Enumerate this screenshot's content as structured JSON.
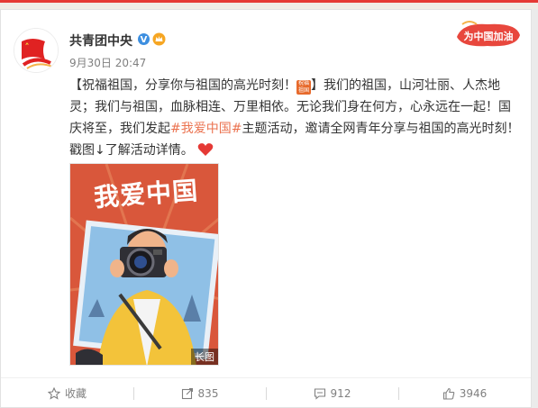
{
  "user": {
    "name": "共青团中央",
    "verified_icon": "verified-icon",
    "badge_icon": "crown-icon"
  },
  "post": {
    "time": "9月30日 20:47",
    "text_part1": "【祝福祖国，分享你与祖国的高光时刻！",
    "sticker_text": "祝福祖国",
    "text_part2": "】我们的祖国，山河壮丽、人杰地灵；我们与祖国，血脉相连、万里相依。无论我们身在何方，心永远在一起！国庆将至，我们发起",
    "topic": "#我爱中国#",
    "text_part3": "主题活动，邀请全网青年分享与祖国的高光时刻！戳图↓了解活动详情。",
    "emoji": "heart-icon"
  },
  "image": {
    "title": "我爱中国",
    "long_tag": "长图"
  },
  "campaign": {
    "label": "为中国加油"
  },
  "actions": [
    {
      "label": "收藏",
      "icon": "star-icon"
    },
    {
      "label": "835",
      "icon": "share-icon"
    },
    {
      "label": "912",
      "icon": "comment-icon"
    },
    {
      "label": "3946",
      "icon": "like-icon"
    }
  ],
  "colors": {
    "accent": "#eb7350",
    "poster_bg": "#d9573b",
    "verify": "#3d8fe0",
    "heart": "#e53935"
  }
}
